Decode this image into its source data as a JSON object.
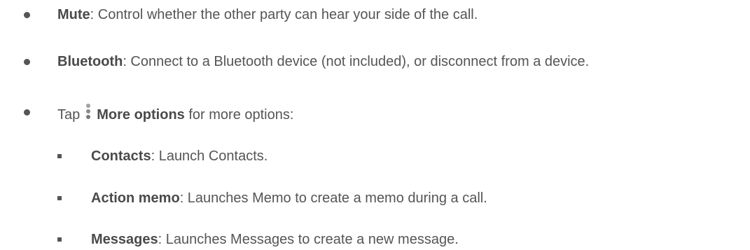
{
  "items": [
    {
      "term": "Mute",
      "desc": ": Control whether the other party can hear your side of the call."
    },
    {
      "term": "Bluetooth",
      "desc": ": Connect to a Bluetooth device (not included), or disconnect from a device."
    },
    {
      "prefix": "Tap",
      "icon": "more-options-icon",
      "term": "More options",
      "desc": " for more options:"
    }
  ],
  "subitems": [
    {
      "term": "Contacts",
      "desc": ": Launch Contacts."
    },
    {
      "term": "Action memo",
      "desc": ": Launches Memo to create a memo during a call."
    },
    {
      "term": "Messages",
      "desc": ": Launches Messages to create a new message."
    }
  ]
}
